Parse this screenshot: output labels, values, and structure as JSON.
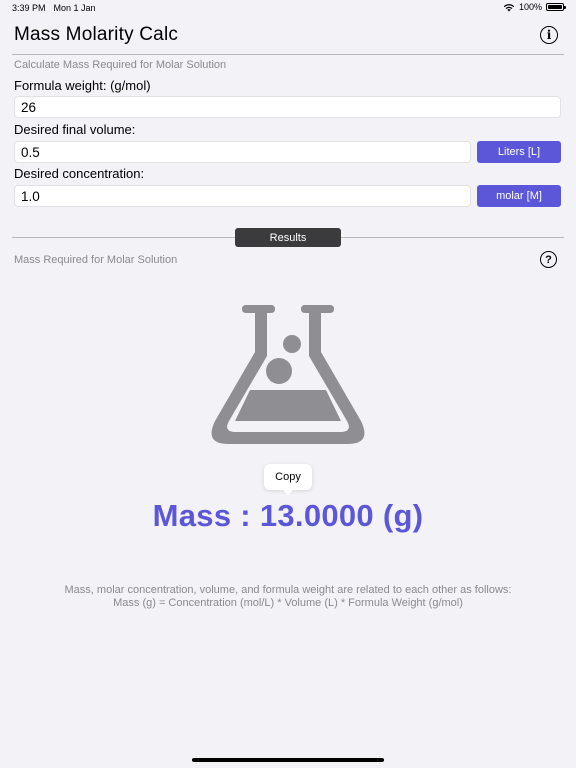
{
  "status_bar": {
    "time": "3:39 PM",
    "date": "Mon 1 Jan",
    "battery": "100%"
  },
  "nav": {
    "title": "Mass Molarity Calc",
    "info_icon": "info-circle-icon"
  },
  "input_section": {
    "subtitle": "Calculate Mass Required for Molar Solution",
    "formula_weight": {
      "label": "Formula weight:  (g/mol)",
      "value": "26"
    },
    "final_volume": {
      "label": "Desired final volume:",
      "value": "0.5",
      "unit_button": "Liters [L]"
    },
    "concentration": {
      "label": "Desired concentration:",
      "value": "1.0",
      "unit_button": "molar [M]"
    }
  },
  "results_section": {
    "pill_label": "Results",
    "subtitle": "Mass Required for Molar Solution",
    "help_icon": "question-circle-icon",
    "copy_label": "Copy",
    "mass_text": "Mass : 13.0000 (g)",
    "explanation_line1": "Mass, molar concentration, volume, and formula weight are related to each other as follows:",
    "explanation_line2": "Mass (g) = Concentration (mol/L) * Volume (L) * Formula Weight (g/mol)"
  },
  "colors": {
    "accent": "#5b57d8",
    "background": "#f2f2f7",
    "flask_gray": "#8e8e93",
    "pill_dark": "#3b3b3d"
  }
}
